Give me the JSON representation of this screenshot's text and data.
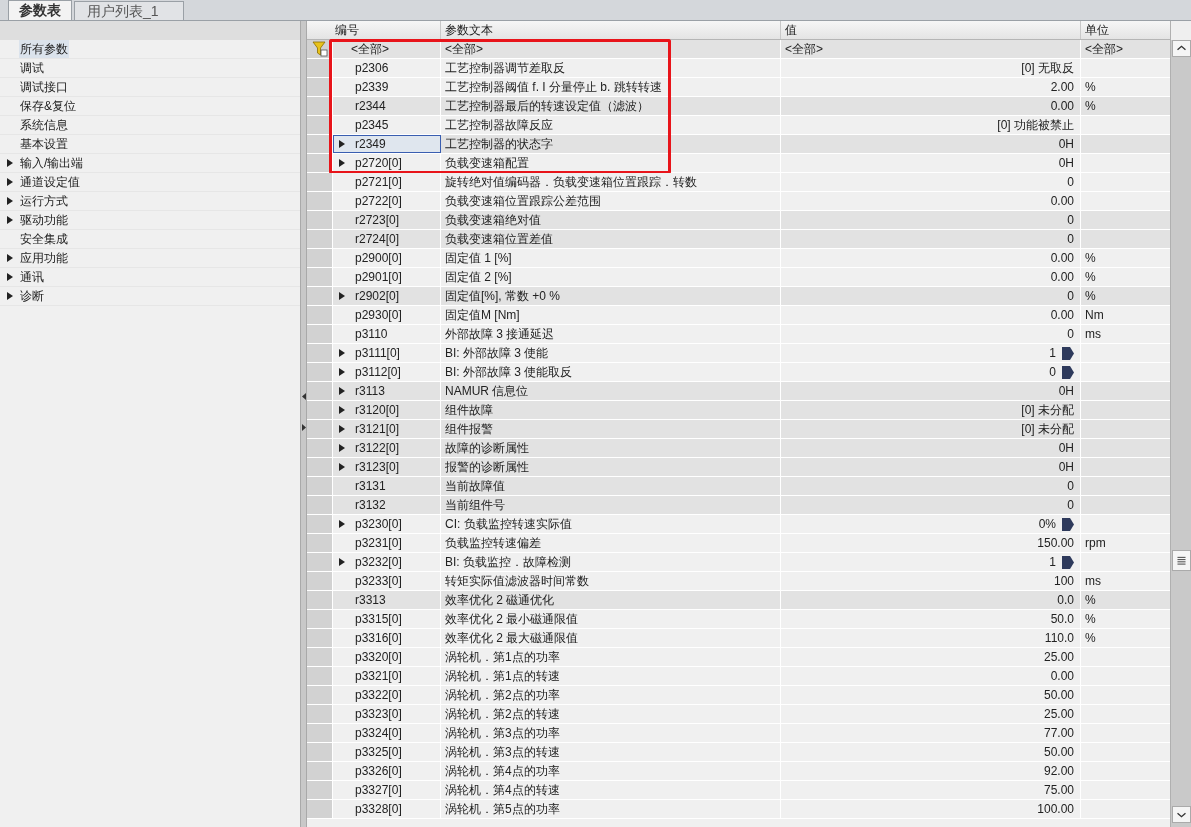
{
  "tabs": [
    {
      "label": "参数表",
      "selected": true
    },
    {
      "label": "用户列表_1",
      "selected": false
    }
  ],
  "sidebar": {
    "items": [
      {
        "label": "所有参数",
        "expandable": false,
        "selected": true
      },
      {
        "label": "调试",
        "expandable": false,
        "selected": false
      },
      {
        "label": "调试接口",
        "expandable": false,
        "selected": false
      },
      {
        "label": "保存&复位",
        "expandable": false,
        "selected": false
      },
      {
        "label": "系统信息",
        "expandable": false,
        "selected": false
      },
      {
        "label": "基本设置",
        "expandable": false,
        "selected": false
      },
      {
        "label": "输入/输出端",
        "expandable": true,
        "selected": false
      },
      {
        "label": "通道设定值",
        "expandable": true,
        "selected": false
      },
      {
        "label": "运行方式",
        "expandable": true,
        "selected": false
      },
      {
        "label": "驱动功能",
        "expandable": true,
        "selected": false
      },
      {
        "label": "安全集成",
        "expandable": false,
        "selected": false
      },
      {
        "label": "应用功能",
        "expandable": true,
        "selected": false
      },
      {
        "label": "通讯",
        "expandable": true,
        "selected": false
      },
      {
        "label": "诊断",
        "expandable": true,
        "selected": false
      }
    ]
  },
  "table": {
    "columns": [
      "编号",
      "参数文本",
      "值",
      "单位"
    ],
    "filter": {
      "number": "<全部>",
      "text": "<全部>",
      "value": "<全部>",
      "unit": "<全部>",
      "highlighted": true
    },
    "rows": [
      {
        "number": "p2306",
        "text": "工艺控制器调节差取反",
        "value": "[0] 无取反",
        "unit": "",
        "read_only": false,
        "expandable": false,
        "connector": false,
        "selected": false,
        "highlighted": true
      },
      {
        "number": "p2339",
        "text": "工艺控制器阈值 f. I 分量停止 b. 跳转转速",
        "value": "2.00",
        "unit": "%",
        "read_only": false,
        "expandable": false,
        "connector": false,
        "selected": false,
        "highlighted": true
      },
      {
        "number": "r2344",
        "text": "工艺控制器最后的转速设定值（滤波）",
        "value": "0.00",
        "unit": "%",
        "read_only": true,
        "expandable": false,
        "connector": false,
        "selected": false,
        "highlighted": true
      },
      {
        "number": "p2345",
        "text": "工艺控制器故障反应",
        "value": "[0] 功能被禁止",
        "unit": "",
        "read_only": false,
        "expandable": false,
        "connector": false,
        "selected": false,
        "highlighted": true
      },
      {
        "number": "r2349",
        "text": "工艺控制器的状态字",
        "value": "0H",
        "unit": "",
        "read_only": true,
        "expandable": true,
        "connector": false,
        "selected": true,
        "highlighted": true
      },
      {
        "number": "p2720[0]",
        "text": "负载变速箱配置",
        "value": "0H",
        "unit": "",
        "read_only": false,
        "expandable": true,
        "connector": false,
        "selected": false,
        "highlighted": true
      },
      {
        "number": "p2721[0]",
        "text": "旋转绝对值编码器．负载变速箱位置跟踪．转数",
        "value": "0",
        "unit": "",
        "read_only": false,
        "expandable": false,
        "connector": false,
        "selected": false,
        "highlighted": false
      },
      {
        "number": "p2722[0]",
        "text": "负载变速箱位置跟踪公差范围",
        "value": "0.00",
        "unit": "",
        "read_only": false,
        "expandable": false,
        "connector": false,
        "selected": false,
        "highlighted": false
      },
      {
        "number": "r2723[0]",
        "text": "负载变速箱绝对值",
        "value": "0",
        "unit": "",
        "read_only": true,
        "expandable": false,
        "connector": false,
        "selected": false,
        "highlighted": false
      },
      {
        "number": "r2724[0]",
        "text": "负载变速箱位置差值",
        "value": "0",
        "unit": "",
        "read_only": true,
        "expandable": false,
        "connector": false,
        "selected": false,
        "highlighted": false
      },
      {
        "number": "p2900[0]",
        "text": "固定值 1 [%]",
        "value": "0.00",
        "unit": "%",
        "read_only": false,
        "expandable": false,
        "connector": false,
        "selected": false,
        "highlighted": false
      },
      {
        "number": "p2901[0]",
        "text": "固定值 2 [%]",
        "value": "0.00",
        "unit": "%",
        "read_only": false,
        "expandable": false,
        "connector": false,
        "selected": false,
        "highlighted": false
      },
      {
        "number": "r2902[0]",
        "text": "固定值[%], 常数 +0 %",
        "value": "0",
        "unit": "%",
        "read_only": true,
        "expandable": true,
        "connector": false,
        "selected": false,
        "highlighted": false
      },
      {
        "number": "p2930[0]",
        "text": "固定值M [Nm]",
        "value": "0.00",
        "unit": "Nm",
        "read_only": false,
        "expandable": false,
        "connector": false,
        "selected": false,
        "highlighted": false
      },
      {
        "number": "p3110",
        "text": "外部故障 3 接通延迟",
        "value": "0",
        "unit": "ms",
        "read_only": false,
        "expandable": false,
        "connector": false,
        "selected": false,
        "highlighted": false
      },
      {
        "number": "p3111[0]",
        "text": "BI: 外部故障 3 使能",
        "value": "1",
        "unit": "",
        "read_only": false,
        "expandable": true,
        "connector": true,
        "selected": false,
        "highlighted": false
      },
      {
        "number": "p3112[0]",
        "text": "BI: 外部故障 3 使能取反",
        "value": "0",
        "unit": "",
        "read_only": false,
        "expandable": true,
        "connector": true,
        "selected": false,
        "highlighted": false
      },
      {
        "number": "r3113",
        "text": "NAMUR 信息位",
        "value": "0H",
        "unit": "",
        "read_only": true,
        "expandable": true,
        "connector": false,
        "selected": false,
        "highlighted": false
      },
      {
        "number": "r3120[0]",
        "text": "组件故障",
        "value": "[0] 未分配",
        "unit": "",
        "read_only": true,
        "expandable": true,
        "connector": false,
        "selected": false,
        "highlighted": false
      },
      {
        "number": "r3121[0]",
        "text": "组件报警",
        "value": "[0] 未分配",
        "unit": "",
        "read_only": true,
        "expandable": true,
        "connector": false,
        "selected": false,
        "highlighted": false
      },
      {
        "number": "r3122[0]",
        "text": "故障的诊断属性",
        "value": "0H",
        "unit": "",
        "read_only": true,
        "expandable": true,
        "connector": false,
        "selected": false,
        "highlighted": false
      },
      {
        "number": "r3123[0]",
        "text": "报警的诊断属性",
        "value": "0H",
        "unit": "",
        "read_only": true,
        "expandable": true,
        "connector": false,
        "selected": false,
        "highlighted": false
      },
      {
        "number": "r3131",
        "text": "当前故障值",
        "value": "0",
        "unit": "",
        "read_only": true,
        "expandable": false,
        "connector": false,
        "selected": false,
        "highlighted": false
      },
      {
        "number": "r3132",
        "text": "当前组件号",
        "value": "0",
        "unit": "",
        "read_only": true,
        "expandable": false,
        "connector": false,
        "selected": false,
        "highlighted": false
      },
      {
        "number": "p3230[0]",
        "text": "CI: 负载监控转速实际值",
        "value": "0%",
        "unit": "",
        "read_only": false,
        "expandable": true,
        "connector": true,
        "selected": false,
        "highlighted": false
      },
      {
        "number": "p3231[0]",
        "text": "负载监控转速偏差",
        "value": "150.00",
        "unit": "rpm",
        "read_only": false,
        "expandable": false,
        "connector": false,
        "selected": false,
        "highlighted": false
      },
      {
        "number": "p3232[0]",
        "text": "BI: 负载监控．故障检测",
        "value": "1",
        "unit": "",
        "read_only": false,
        "expandable": true,
        "connector": true,
        "selected": false,
        "highlighted": false
      },
      {
        "number": "p3233[0]",
        "text": "转矩实际值滤波器时间常数",
        "value": "100",
        "unit": "ms",
        "read_only": false,
        "expandable": false,
        "connector": false,
        "selected": false,
        "highlighted": false
      },
      {
        "number": "r3313",
        "text": "效率优化 2 磁通优化",
        "value": "0.0",
        "unit": "%",
        "read_only": true,
        "expandable": false,
        "connector": false,
        "selected": false,
        "highlighted": false
      },
      {
        "number": "p3315[0]",
        "text": "效率优化 2 最小磁通限值",
        "value": "50.0",
        "unit": "%",
        "read_only": false,
        "expandable": false,
        "connector": false,
        "selected": false,
        "highlighted": false
      },
      {
        "number": "p3316[0]",
        "text": "效率优化 2 最大磁通限值",
        "value": "110.0",
        "unit": "%",
        "read_only": false,
        "expandable": false,
        "connector": false,
        "selected": false,
        "highlighted": false
      },
      {
        "number": "p3320[0]",
        "text": "涡轮机．第1点的功率",
        "value": "25.00",
        "unit": "",
        "read_only": false,
        "expandable": false,
        "connector": false,
        "selected": false,
        "highlighted": false
      },
      {
        "number": "p3321[0]",
        "text": "涡轮机．第1点的转速",
        "value": "0.00",
        "unit": "",
        "read_only": false,
        "expandable": false,
        "connector": false,
        "selected": false,
        "highlighted": false
      },
      {
        "number": "p3322[0]",
        "text": "涡轮机．第2点的功率",
        "value": "50.00",
        "unit": "",
        "read_only": false,
        "expandable": false,
        "connector": false,
        "selected": false,
        "highlighted": false
      },
      {
        "number": "p3323[0]",
        "text": "涡轮机．第2点的转速",
        "value": "25.00",
        "unit": "",
        "read_only": false,
        "expandable": false,
        "connector": false,
        "selected": false,
        "highlighted": false
      },
      {
        "number": "p3324[0]",
        "text": "涡轮机．第3点的功率",
        "value": "77.00",
        "unit": "",
        "read_only": false,
        "expandable": false,
        "connector": false,
        "selected": false,
        "highlighted": false
      },
      {
        "number": "p3325[0]",
        "text": "涡轮机．第3点的转速",
        "value": "50.00",
        "unit": "",
        "read_only": false,
        "expandable": false,
        "connector": false,
        "selected": false,
        "highlighted": false
      },
      {
        "number": "p3326[0]",
        "text": "涡轮机．第4点的功率",
        "value": "92.00",
        "unit": "",
        "read_only": false,
        "expandable": false,
        "connector": false,
        "selected": false,
        "highlighted": false
      },
      {
        "number": "p3327[0]",
        "text": "涡轮机．第4点的转速",
        "value": "75.00",
        "unit": "",
        "read_only": false,
        "expandable": false,
        "connector": false,
        "selected": false,
        "highlighted": false
      },
      {
        "number": "p3328[0]",
        "text": "涡轮机．第5点的功率",
        "value": "100.00",
        "unit": "",
        "read_only": false,
        "expandable": false,
        "connector": false,
        "selected": false,
        "highlighted": false
      }
    ]
  }
}
